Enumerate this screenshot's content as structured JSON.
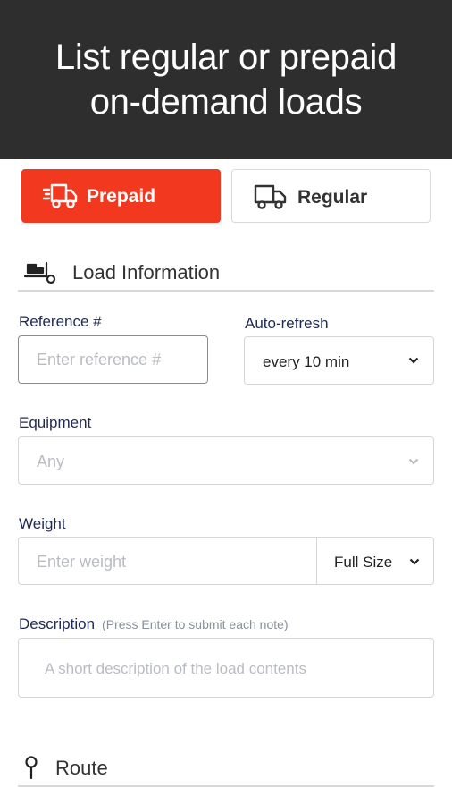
{
  "banner": {
    "line1": "List regular or prepaid",
    "line2": "on-demand loads"
  },
  "toggle": {
    "prepaid_label": "Prepaid",
    "regular_label": "Regular",
    "selected": "Prepaid",
    "accent_color": "#f2381f"
  },
  "load_info": {
    "title": "Load Information",
    "icon": "load-cart-icon"
  },
  "reference": {
    "label": "Reference #",
    "placeholder": "Enter reference #"
  },
  "auto_refresh": {
    "label": "Auto-refresh",
    "value": "every 10 min"
  },
  "equipment": {
    "label": "Equipment",
    "value": "Any"
  },
  "weight": {
    "label": "Weight",
    "placeholder": "Enter weight",
    "unit": "Full Size"
  },
  "description": {
    "label": "Description",
    "hint": "(Press Enter to submit each note)",
    "placeholder": "A short description of the load contents"
  },
  "route": {
    "title": "Route",
    "icon": "location-pin-icon"
  }
}
